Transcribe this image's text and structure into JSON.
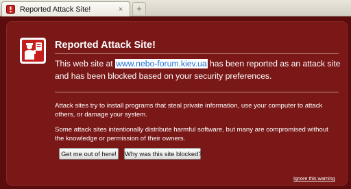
{
  "tab": {
    "title": "Reported Attack Site!",
    "close_glyph": "×",
    "new_tab_glyph": "+",
    "icon": "warning-shield-icon"
  },
  "colors": {
    "page_background": "#5b0d0d",
    "panel_background": "#7a1818",
    "link_text": "#1d6fd1"
  },
  "warning": {
    "title": "Reported Attack Site!",
    "intro_before": "This web site at ",
    "site": "www.nebo-forum.kiev.ua",
    "intro_after": " has been reported as an attack site and has been blocked based on your security preferences.",
    "paragraph1": "Attack sites try to install programs that steal private information, use your computer to attack others, or damage your system.",
    "paragraph2": "Some attack sites intentionally distribute harmful software, but many are compromised without the knowledge or permission of their owners.",
    "get_out_button": "Get me out of here!",
    "why_blocked_button": "Why was this site blocked?",
    "ignore_link": "Ignore this warning",
    "icon": "police-officer-shield-icon"
  }
}
